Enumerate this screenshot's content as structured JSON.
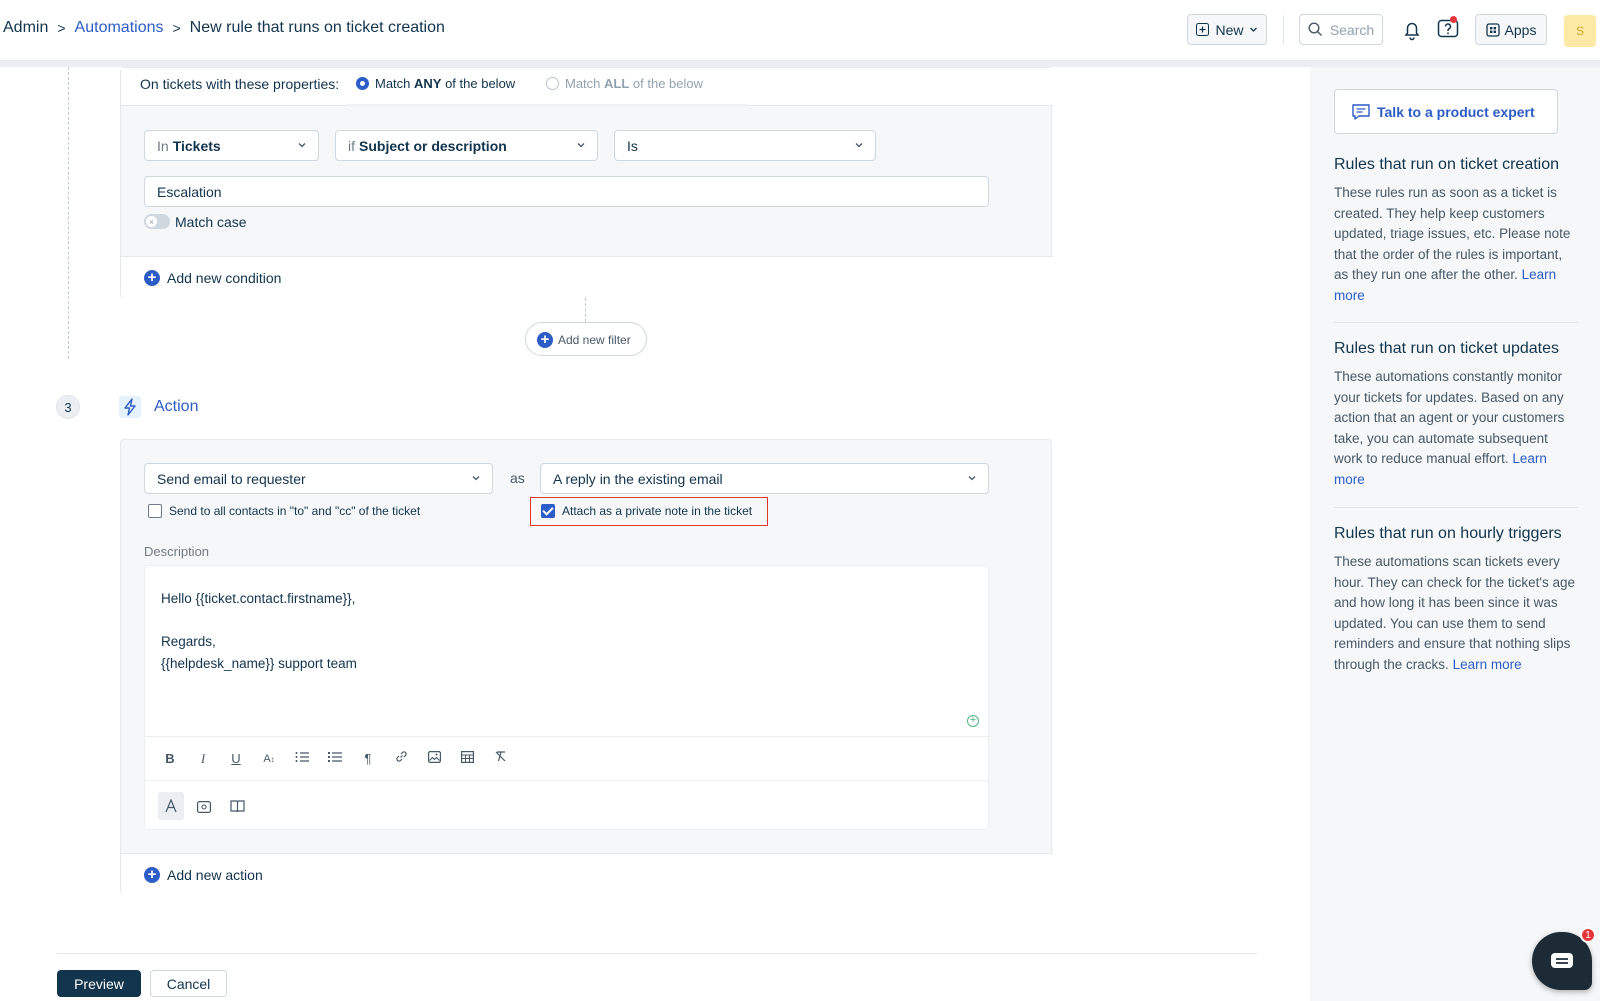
{
  "breadcrumb": {
    "root": "Admin",
    "parent": "Automations",
    "current": "New rule that runs on ticket creation",
    "separator": ">"
  },
  "topbar": {
    "new_label": "New",
    "search_placeholder": "Search",
    "apps_label": "Apps",
    "avatar_initial": "S"
  },
  "conditions": {
    "properties_label": "On tickets with these properties:",
    "match_any_label": "Match ANY of the below",
    "match_all_label": "Match ALL of the below",
    "selected_match": "any",
    "in_prefix": "In",
    "in_value": "Tickets",
    "if_prefix": "if",
    "field_value": "Subject or description",
    "operator_value": "Is",
    "text_value": "Escalation",
    "match_case_label": "Match case",
    "match_case_on": false,
    "add_condition_label": "Add new condition",
    "add_filter_label": "Add new filter"
  },
  "action_step": {
    "number": "3",
    "title": "Action",
    "action_value": "Send email to requester",
    "as_label": "as",
    "reply_value": "A reply in the existing email",
    "send_all_label": "Send to all contacts in \"to\" and \"cc\" of the ticket",
    "send_all_checked": false,
    "private_note_label": "Attach as a private note in the ticket",
    "private_note_checked": true,
    "description_label": "Description",
    "body_line1": "Hello {{ticket.contact.firstname}},",
    "body_line2": "Regards,",
    "body_line3": "{{helpdesk_name}} support team",
    "add_action_label": "Add new action"
  },
  "editor_toolbar": [
    "bold-icon",
    "italic-icon",
    "underline-icon",
    "font-size-icon",
    "ordered-list-icon",
    "bullet-list-icon",
    "paragraph-icon",
    "link-icon",
    "image-icon",
    "table-icon",
    "clear-format-icon"
  ],
  "footer": {
    "preview_label": "Preview",
    "cancel_label": "Cancel"
  },
  "sidebar": {
    "talk_label": "Talk to a product expert",
    "sections": [
      {
        "title": "Rules that run on ticket creation",
        "body": "These rules run as soon as a ticket is created. They help keep customers updated, triage issues, etc. Please note that the order of the rules is important, as they run one after the other.",
        "link": "Learn more"
      },
      {
        "title": "Rules that run on ticket updates",
        "body": "These automations constantly monitor your tickets for updates. Based on any action that an agent or your customers take, you can automate subsequent work to reduce manual effort.",
        "link": "Learn more"
      },
      {
        "title": "Rules that run on hourly triggers",
        "body": "These automations scan tickets every hour. They can check for the ticket's age and how long it has been since it was updated. You can use them to send reminders and ensure that nothing slips through the cracks.",
        "link": "Learn more"
      }
    ]
  },
  "chat": {
    "badge_count": "1"
  },
  "colors": {
    "accent": "#2c5cc5",
    "primary_dark": "#12344d",
    "highlight": "#e0392b"
  }
}
